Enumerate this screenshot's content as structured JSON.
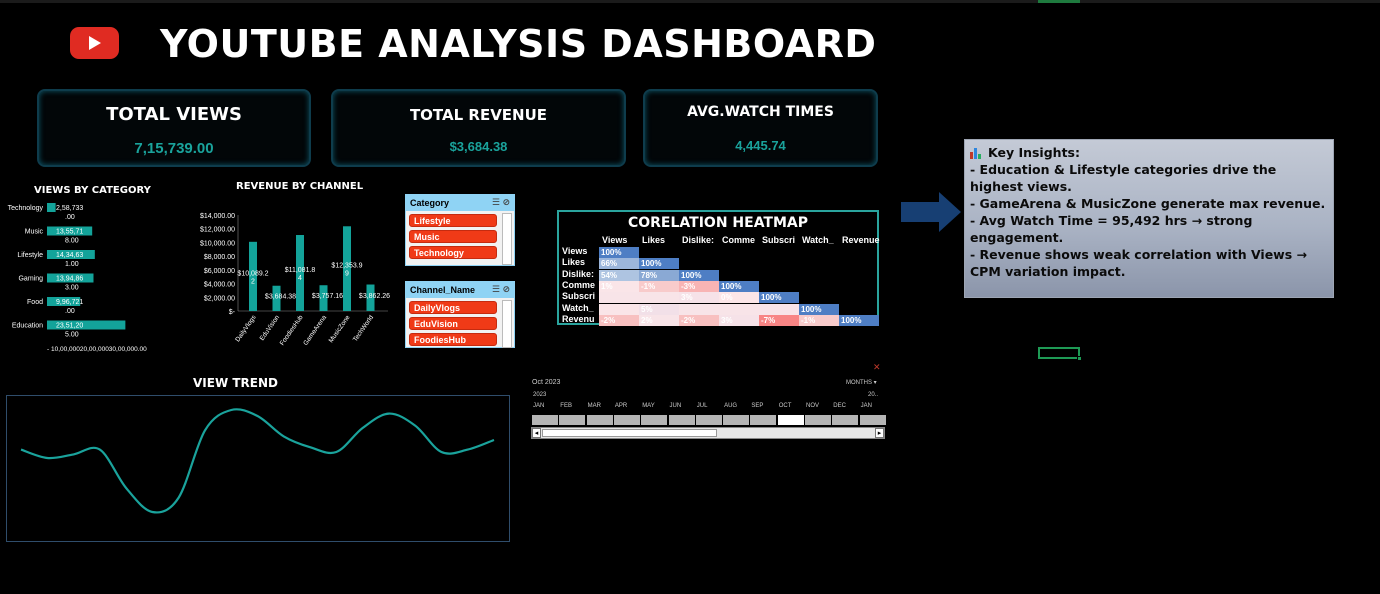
{
  "header": {
    "title": "YOUTUBE ANALYSIS DASHBOARD",
    "logo_icon": "youtube-play-icon"
  },
  "kpis": [
    {
      "label": "TOTAL VIEWS",
      "value": "7,15,739.00"
    },
    {
      "label": "TOTAL REVENUE",
      "value": "$3,684.38"
    },
    {
      "label": "AVG.WATCH TIMES",
      "value": "4,445.74"
    }
  ],
  "views_by_category": {
    "title": "VIEWS BY CATEGORY",
    "bars": [
      {
        "label": "Technology",
        "value_label": "2,58,733",
        "sub_label": ".00"
      },
      {
        "label": "Music",
        "value_label": "13,55,71",
        "sub_label": "8.00"
      },
      {
        "label": "Lifestyle",
        "value_label": "14,34,63",
        "sub_label": "1.00"
      },
      {
        "label": "Gaming",
        "value_label": "13,94,86",
        "sub_label": "3.00"
      },
      {
        "label": "Food",
        "value_label": "9,96,721",
        "sub_label": ".00"
      },
      {
        "label": "Education",
        "value_label": "23,51,20",
        "sub_label": "5.00"
      }
    ],
    "x_axis_text": "-       10,00,00020,00,00030,00,000.00"
  },
  "chart_data": {
    "type": "bar",
    "title": "REVENUE BY CHANNEL",
    "categories": [
      "DailyVlogs",
      "EduVision",
      "FoodiesHub",
      "GameArena",
      "MusicZone",
      "TechWorld"
    ],
    "values": [
      10089.22,
      3684.38,
      11081.84,
      3757.16,
      12353.99,
      3862.26
    ],
    "data_labels": [
      "$10,089.2\n2",
      "$3,684.38",
      "$11,081.8\n4",
      "$3,757.16",
      "$12,353.9\n9",
      "$3,862.26"
    ],
    "y_ticks": [
      "$-",
      "$2,000.00",
      "$4,000.00",
      "$6,000.00",
      "$8,000.00",
      "$10,000.00",
      "$12,000.00",
      "$14,000.00"
    ],
    "ylim": [
      0,
      14000
    ],
    "color": "#13a39a"
  },
  "slicer_category": {
    "header": "Category",
    "items": [
      "Lifestyle",
      "Music",
      "Technology"
    ]
  },
  "slicer_channel": {
    "header": "Channel_Name",
    "items": [
      "DailyVlogs",
      "EduVision",
      "FoodiesHub"
    ]
  },
  "heatmap": {
    "title": "CORELATION HEATMAP",
    "columns": [
      "Views",
      "Likes",
      "Dislike:",
      "Comme",
      "Subscri",
      "Watch_",
      "Revenue"
    ],
    "rows": [
      "Views",
      "Likes",
      "Dislike:",
      "Comme",
      "Subscri",
      "Watch_",
      "Revenu"
    ],
    "values": [
      [
        "100%"
      ],
      [
        "66%",
        "100%"
      ],
      [
        "54%",
        "78%",
        "100%"
      ],
      [
        "1%",
        "-1%",
        "-3%",
        "100%"
      ],
      [
        "",
        "",
        "3%",
        "0%",
        "100%"
      ],
      [
        "",
        "5%",
        "",
        "",
        "",
        "100%"
      ],
      [
        "-2%",
        "2%",
        "-2%",
        "3%",
        "-7%",
        "-1%",
        "100%"
      ]
    ]
  },
  "insights": {
    "title": "Key Insights:",
    "title_icon": "bar-chart-icon",
    "lines": [
      "- Education & Lifestyle categories drive the highest views.",
      "- GameArena & MusicZone generate max revenue.",
      "- Avg Watch Time = 95,492 hrs → strong engagement.",
      "- Revenue shows weak correlation with Views → CPM variation impact."
    ]
  },
  "arrow_icon": "right-arrow-icon",
  "trend": {
    "title": "VIEW TREND",
    "values": [
      0.62,
      0.55,
      0.58,
      0.62,
      0.3,
      0.1,
      0.22,
      0.78,
      0.95,
      0.9,
      0.73,
      0.64,
      0.6,
      0.8,
      0.92,
      0.82,
      0.6,
      0.62,
      0.7
    ]
  },
  "timeline": {
    "current": "Oct 2023",
    "period": "MONTHS ▾",
    "year_start": "2023",
    "year_end": "20..",
    "months": [
      "JAN",
      "FEB",
      "MAR",
      "APR",
      "MAY",
      "JUN",
      "JUL",
      "AUG",
      "SEP",
      "OCT",
      "NOV",
      "DEC",
      "JAN"
    ],
    "selected_index": 9,
    "clear_filter_icon": "clear-filter-icon"
  }
}
